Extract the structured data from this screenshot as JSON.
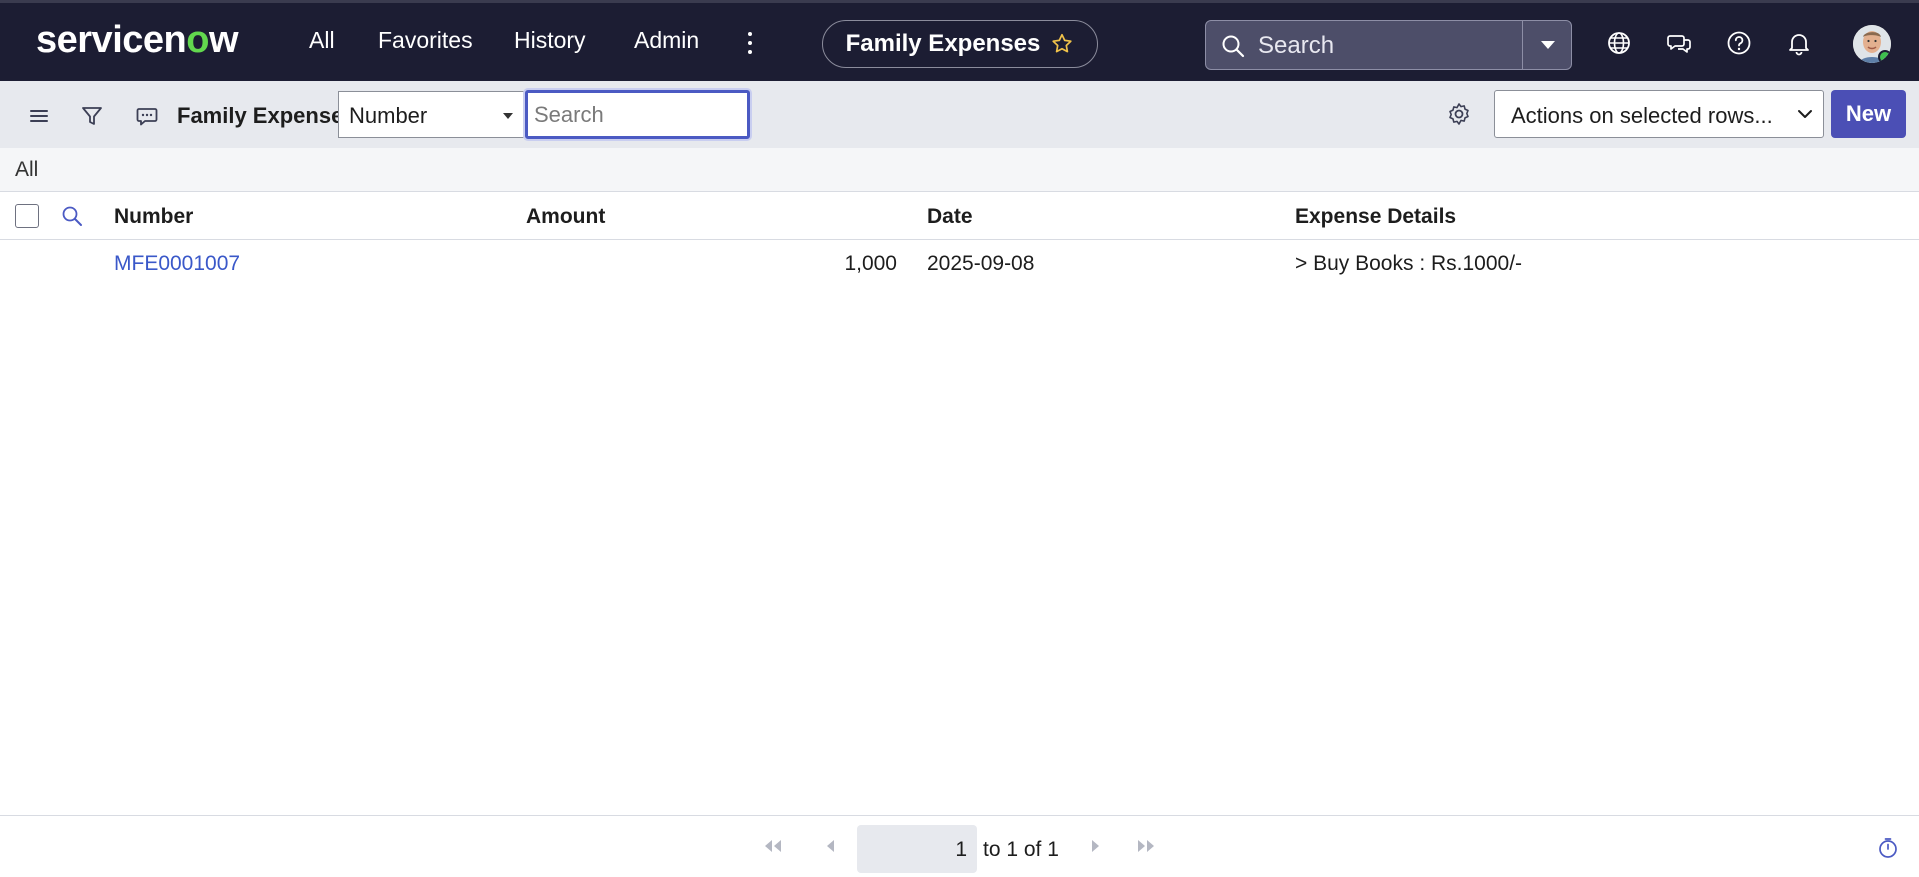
{
  "topnav": {
    "logo_prefix": "servicen",
    "logo_o": "o",
    "logo_suffix": "w",
    "links": [
      "All",
      "Favorites",
      "History",
      "Admin"
    ],
    "context_title": "Family Expenses",
    "search_placeholder": "Search",
    "icons": [
      "more-icon",
      "star-icon",
      "search-icon",
      "caret-down-icon",
      "globe-icon",
      "chat-icon",
      "help-icon",
      "bell-icon"
    ]
  },
  "listbar": {
    "title": "Family Expenses",
    "field_selected": "Number",
    "search_placeholder": "Search",
    "actions_label": "Actions on selected rows...",
    "new_label": "New",
    "icons": [
      "menu-icon",
      "filter-icon",
      "comment-icon",
      "gear-icon"
    ]
  },
  "breadcrumb": {
    "label": "All"
  },
  "table": {
    "columns": [
      "Number",
      "Amount",
      "Date",
      "Expense Details"
    ],
    "rows": [
      {
        "number": "MFE0001007",
        "amount": "1,000",
        "date": "2025-09-08",
        "details": "> Buy Books : Rs.1000/-"
      }
    ]
  },
  "pagination": {
    "current_page": "1",
    "range_text": "to 1 of 1"
  },
  "colors": {
    "nav_bg": "#1c1d33",
    "accent": "#4b4fb5",
    "link": "#3a58c9",
    "logo_green": "#62d84e"
  }
}
